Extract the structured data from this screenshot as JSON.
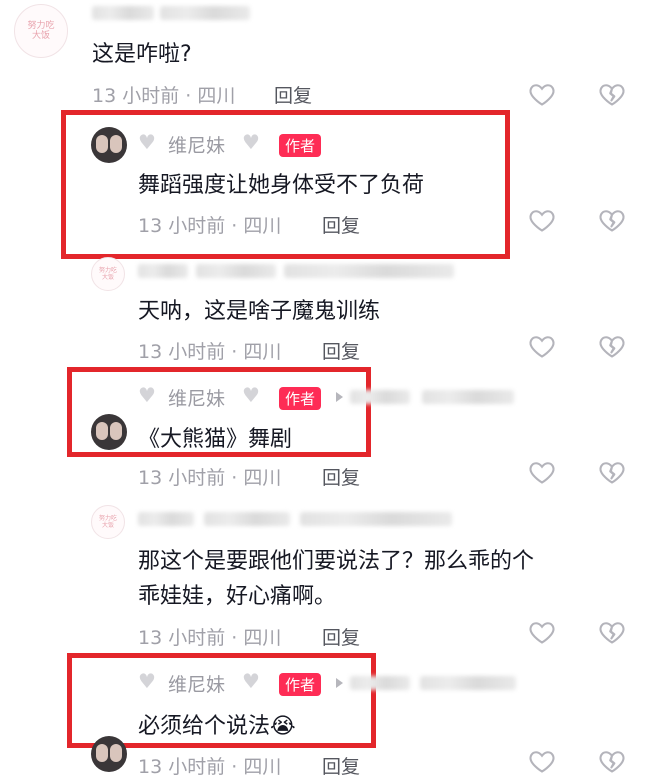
{
  "comments": [
    {
      "text": "这是咋啦?",
      "time": "13 小时前 · 四川",
      "reply": "回复"
    },
    {
      "name": "维尼妹",
      "badge": "作者",
      "text": "舞蹈强度让她身体受不了负荷",
      "time": "13 小时前 · 四川",
      "reply": "回复"
    },
    {
      "text": "天呐，这是啥子魔鬼训练",
      "time": "13 小时前 · 四川",
      "reply": "回复"
    },
    {
      "name": "维尼妹",
      "badge": "作者",
      "text": "《大熊猫》舞剧",
      "time": "13 小时前 · 四川",
      "reply": "回复"
    },
    {
      "text_line1": "那这个是要跟他们要说法了？那么乖的个",
      "text_line2": "乖娃娃，好心痛啊。",
      "time": "13 小时前 · 四川",
      "reply": "回复"
    },
    {
      "name": "维尼妹",
      "badge": "作者",
      "text": "必须给个说法😭",
      "time": "13 小时前 · 四川",
      "reply": "回复"
    }
  ],
  "avatar_text": "努力吃\n大饭",
  "icons": {
    "like": "heart-outline-icon",
    "dislike": "broken-heart-icon",
    "name_decoration": "white-heart-icon",
    "reply_arrow": "play-arrow-icon"
  },
  "colors": {
    "badge": "#fe2c55",
    "highlight_box": "#e3262b",
    "meta_text": "#a0a0a8",
    "body_text": "#161823"
  }
}
